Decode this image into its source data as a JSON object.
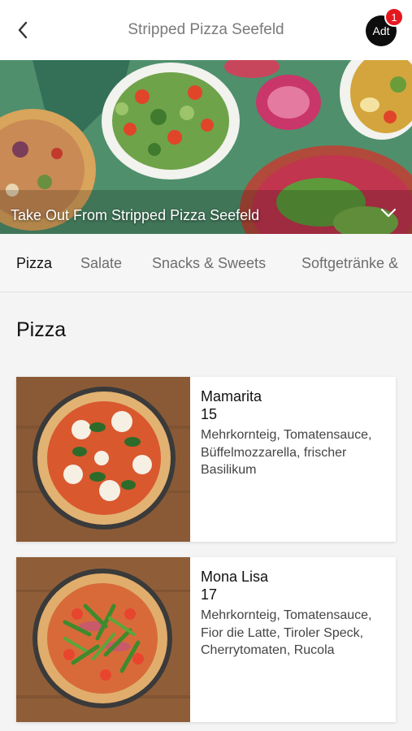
{
  "header": {
    "title": "Stripped Pizza Seefeld",
    "avatar_label": "Adt",
    "notification_count": "1"
  },
  "hero": {
    "title": "Take Out From Stripped Pizza Seefeld"
  },
  "tabs": [
    {
      "label": "Pizza",
      "active": true
    },
    {
      "label": "Salate",
      "active": false
    },
    {
      "label": "Snacks & Sweets",
      "active": false
    },
    {
      "label": "Softgetränke &",
      "active": false
    }
  ],
  "section": {
    "title": "Pizza"
  },
  "items": [
    {
      "name": "Mamarita",
      "price": "15",
      "description": "Mehrkornteig, Tomatensauce, Büffelmozzarella, frischer Basilikum"
    },
    {
      "name": "Mona Lisa",
      "price": "17",
      "description": "Mehrkornteig, Tomatensauce, Fior die Latte, Tiroler Speck, Cherrytomaten, Rucola"
    }
  ],
  "colors": {
    "accent_badge": "#e5181f",
    "avatar_bg": "#0d0d0d",
    "hero_bg": "#4f8f6c"
  }
}
